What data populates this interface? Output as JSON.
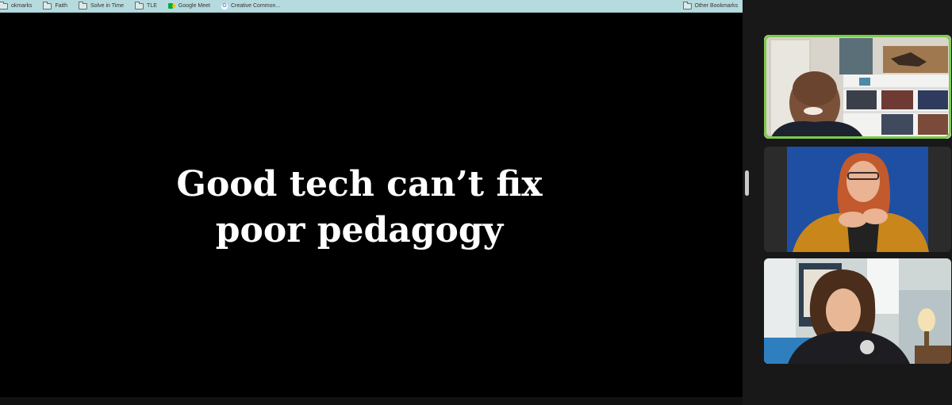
{
  "bookmarks_bar": {
    "items": [
      {
        "label": "okmarks",
        "icon": "folder-icon"
      },
      {
        "label": "Faith",
        "icon": "folder-icon"
      },
      {
        "label": "Solve in Time",
        "icon": "folder-icon"
      },
      {
        "label": "TLE",
        "icon": "folder-icon"
      },
      {
        "label": "Google Meet",
        "icon": "google-meet-icon"
      },
      {
        "label": "Creative Common...",
        "icon": "google-icon"
      }
    ],
    "other_bookmarks": {
      "label": "Other Bookmarks",
      "icon": "folder-icon"
    }
  },
  "slide": {
    "line1": "Good tech can’t fix",
    "line2": "poor pedagogy"
  },
  "participants": [
    {
      "role": "active-speaker",
      "highlight_color": "#7ecb4a"
    },
    {
      "role": "participant"
    },
    {
      "role": "participant"
    }
  ],
  "colors": {
    "bookmarks_bar": "#b6dbdf",
    "slide_background": "#000000",
    "slide_text": "#ffffff",
    "speaker_highlight": "#7ecb4a"
  }
}
